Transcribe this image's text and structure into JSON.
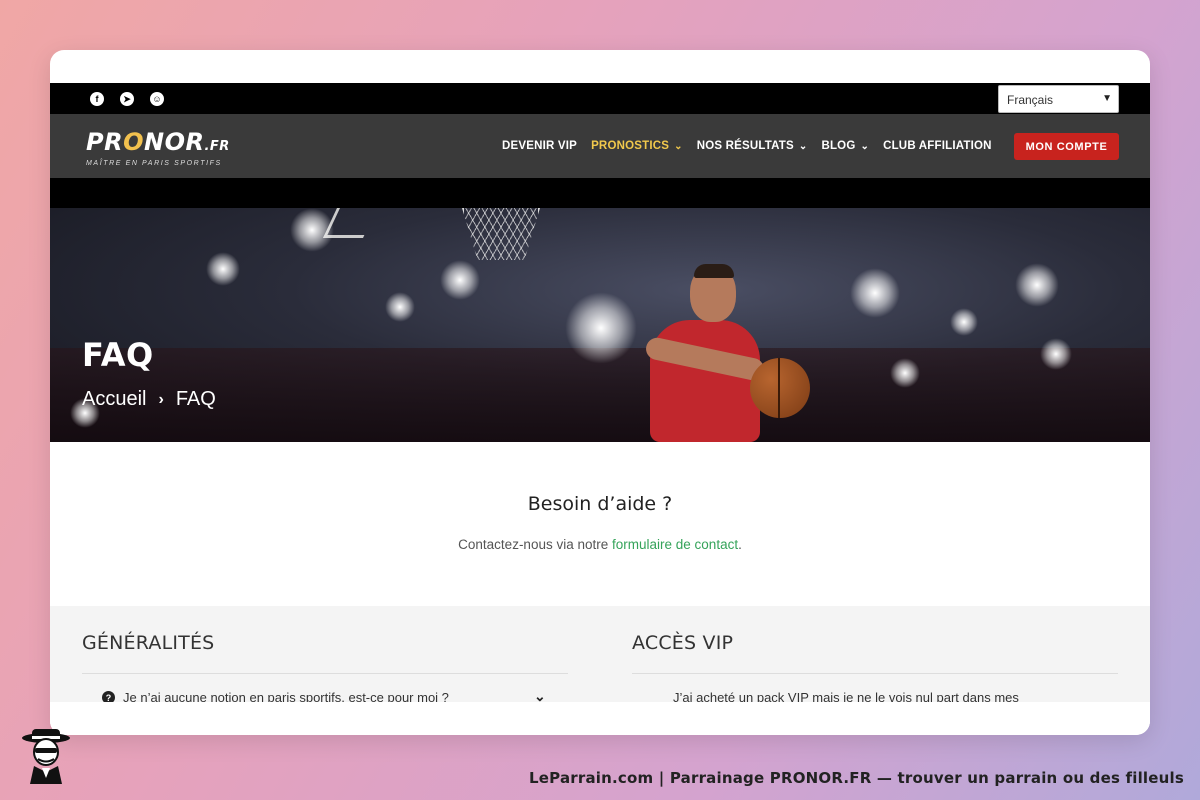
{
  "topbar": {
    "social_icons": [
      "facebook-icon",
      "telegram-icon",
      "snapchat-icon"
    ],
    "language": "Français"
  },
  "logo": {
    "main_a": "PR",
    "main_o": "O",
    "main_b": "NOR",
    "tld": ".FR",
    "tagline": "MAÎTRE EN PARIS SPORTIFS"
  },
  "nav": {
    "items": [
      {
        "label": "DEVENIR VIP",
        "dropdown": false
      },
      {
        "label": "PRONOSTICS",
        "dropdown": true,
        "active": true
      },
      {
        "label": "NOS RÉSULTATS",
        "dropdown": true
      },
      {
        "label": "BLOG",
        "dropdown": true
      },
      {
        "label": "CLUB AFFILIATION",
        "dropdown": false
      }
    ],
    "account_button": "MON COMPTE"
  },
  "hero": {
    "title": "FAQ",
    "breadcrumb_home": "Accueil",
    "breadcrumb_current": "FAQ"
  },
  "help": {
    "title": "Besoin d’aide ?",
    "text_before": "Contactez-nous via notre",
    "link": "formulaire de contact",
    "text_after": "."
  },
  "faq": {
    "left_title": "GÉNÉRALITÉS",
    "left_question": "Je n’ai aucune notion en paris sportifs, est-ce pour moi ?",
    "right_title": "ACCÈS VIP",
    "right_question": "J’ai acheté un pack VIP mais je ne le vois nul part dans mes"
  },
  "footer": {
    "text": "LeParrain.com | Parrainage PRONOR.FR — trouver un parrain ou des filleuls"
  },
  "colors": {
    "accent_yellow": "#f2c94c",
    "account_red": "#c8231e",
    "link_green": "#35a35a"
  }
}
